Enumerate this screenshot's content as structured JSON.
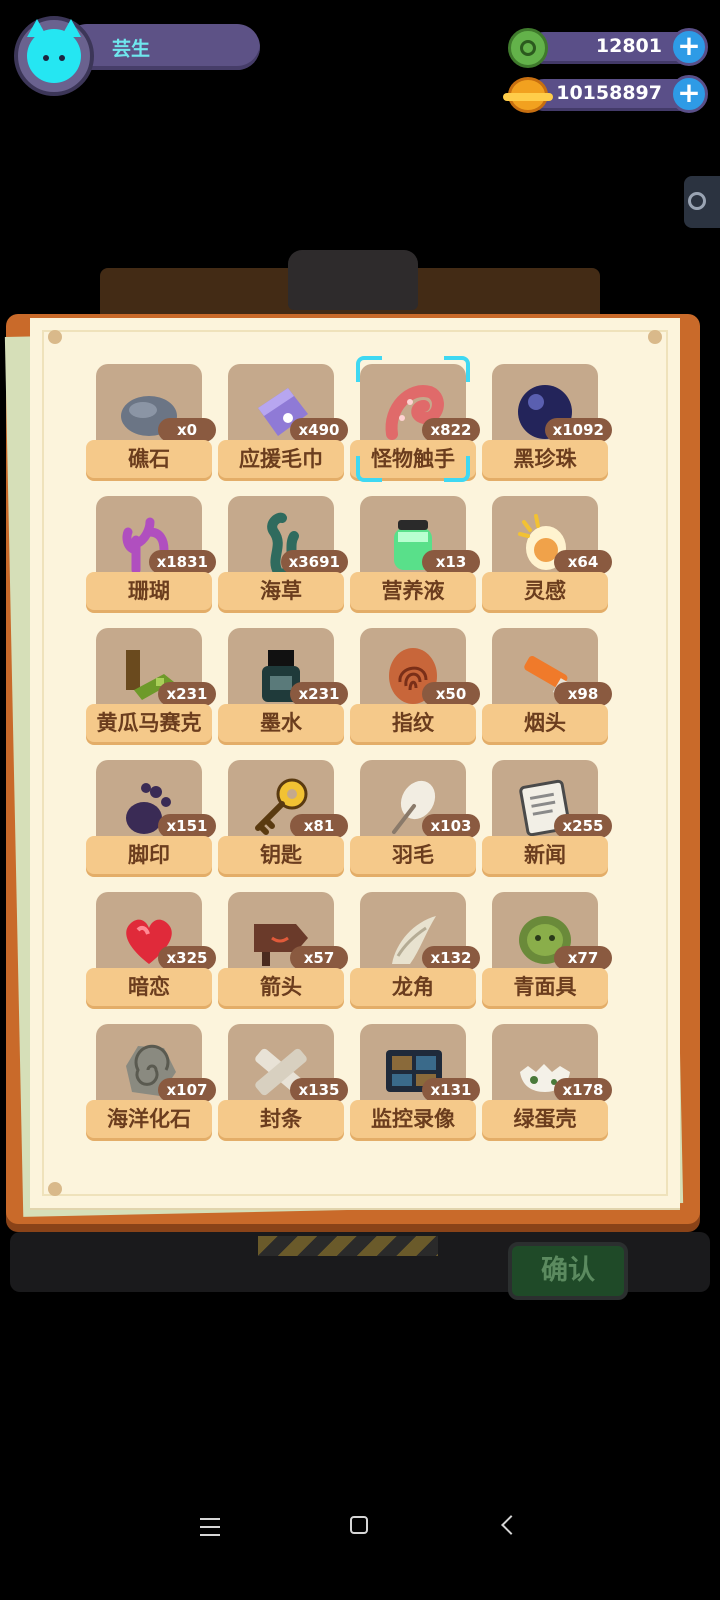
{
  "player": {
    "name": "芸生"
  },
  "currencies": [
    {
      "name": "green-token",
      "value": "12801"
    },
    {
      "name": "gold-planet",
      "value": "10158897"
    }
  ],
  "items": [
    {
      "label": "礁石",
      "count": "x0",
      "icon": "rock-icon"
    },
    {
      "label": "应援毛巾",
      "count": "x490",
      "icon": "towel-icon"
    },
    {
      "label": "怪物触手",
      "count": "x822",
      "icon": "tentacle-icon",
      "selected": true
    },
    {
      "label": "黑珍珠",
      "count": "x1092",
      "icon": "black-pearl-icon"
    },
    {
      "label": "珊瑚",
      "count": "x1831",
      "icon": "coral-icon"
    },
    {
      "label": "海草",
      "count": "x3691",
      "icon": "seaweed-icon"
    },
    {
      "label": "营养液",
      "count": "x13",
      "icon": "nutrient-jar-icon"
    },
    {
      "label": "灵感",
      "count": "x64",
      "icon": "inspiration-icon"
    },
    {
      "label": "黄瓜马赛克",
      "count": "x231",
      "icon": "cucumber-mosaic-icon"
    },
    {
      "label": "墨水",
      "count": "x231",
      "icon": "ink-bottle-icon"
    },
    {
      "label": "指纹",
      "count": "x50",
      "icon": "fingerprint-icon"
    },
    {
      "label": "烟头",
      "count": "x98",
      "icon": "cigarette-butt-icon"
    },
    {
      "label": "脚印",
      "count": "x151",
      "icon": "footprint-icon"
    },
    {
      "label": "钥匙",
      "count": "x81",
      "icon": "key-icon"
    },
    {
      "label": "羽毛",
      "count": "x103",
      "icon": "feather-icon"
    },
    {
      "label": "新闻",
      "count": "x255",
      "icon": "newspaper-icon"
    },
    {
      "label": "暗恋",
      "count": "x325",
      "icon": "heart-icon"
    },
    {
      "label": "箭头",
      "count": "x57",
      "icon": "arrow-sign-icon"
    },
    {
      "label": "龙角",
      "count": "x132",
      "icon": "dragon-horn-icon"
    },
    {
      "label": "青面具",
      "count": "x77",
      "icon": "green-mask-icon"
    },
    {
      "label": "海洋化石",
      "count": "x107",
      "icon": "fossil-icon"
    },
    {
      "label": "封条",
      "count": "x135",
      "icon": "seal-tape-icon"
    },
    {
      "label": "监控录像",
      "count": "x131",
      "icon": "surveillance-video-icon"
    },
    {
      "label": "绿蛋壳",
      "count": "x178",
      "icon": "eggshell-icon"
    }
  ],
  "confirm_label": "确认",
  "colors": {
    "accent_cyan": "#3fd8f2",
    "label_bg": "#f5c98a",
    "count_bg": "#8a5a40",
    "paper": "#fcf4dc"
  }
}
